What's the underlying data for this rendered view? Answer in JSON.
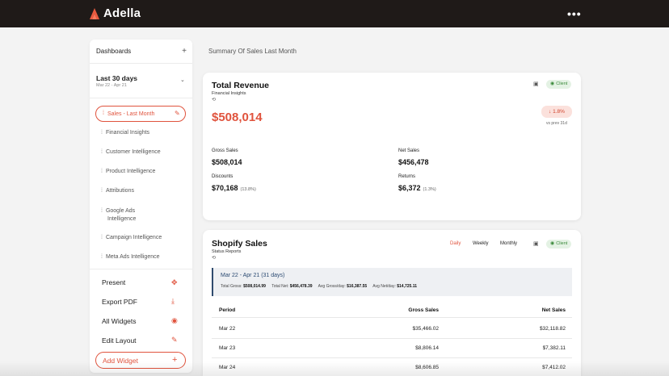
{
  "app": {
    "name": "Adella",
    "more_menu": "•••"
  },
  "sidebar": {
    "header": "Dashboards",
    "header_add": "+",
    "date_range": {
      "title": "Last 30 days",
      "sub": "Mar 22 - Apr 21",
      "chevron": "⌄"
    },
    "active_item": "Sales - Last Month",
    "items": [
      {
        "label": "Financial Insights"
      },
      {
        "label": "Customer Intelligence"
      },
      {
        "label": "Product Intelligence"
      },
      {
        "label": "Attributions"
      },
      {
        "label_line1": "Google Ads",
        "label_line2": "Intelligence"
      },
      {
        "label": "Campaign Intelligence"
      },
      {
        "label": "Meta Ads Intelligence"
      }
    ],
    "actions": [
      {
        "label": "Present",
        "icon": "present-icon"
      },
      {
        "label": "Export PDF",
        "icon": "download-icon"
      },
      {
        "label": "All Widgets",
        "icon": "eye-icon"
      },
      {
        "label": "Edit Layout",
        "icon": "edit-layout-icon"
      }
    ],
    "add_widget": "Add Widget"
  },
  "main": {
    "summary_title": "Summary Of Sales Last Month",
    "revenue_card": {
      "title": "Total Revenue",
      "subtitle": "Financial Insights",
      "badge": "Client",
      "total": "$508,014",
      "delta": "1.8%",
      "delta_sub": "vs prev 31d",
      "metrics": {
        "gross_sales": {
          "label": "Gross Sales",
          "value": "$508,014"
        },
        "net_sales": {
          "label": "Net Sales",
          "value": "$456,478"
        },
        "discounts": {
          "label": "Discounts",
          "value": "$70,168",
          "pct": "(13.8%)"
        },
        "returns": {
          "label": "Returns",
          "value": "$6,372",
          "pct": "(1.3%)"
        }
      }
    },
    "shopify_card": {
      "title": "Shopify Sales",
      "subtitle": "Status Reports",
      "tabs": {
        "daily": "Daily",
        "weekly": "Weekly",
        "monthly": "Monthly"
      },
      "badge": "Client",
      "period": {
        "title": "Mar 22 - Apr 21 (31 days)",
        "total_gross_label": "Total Gross:",
        "total_gross": "$508,014.99",
        "total_net_label": "Total Net:",
        "total_net": "$456,478.39",
        "avg_gross_label": "Avg Gross/day:",
        "avg_gross": "$16,387.55",
        "avg_net_label": "Avg Net/day:",
        "avg_net": "$14,725.11"
      },
      "columns": {
        "period": "Period",
        "gross": "Gross Sales",
        "net": "Net Sales"
      },
      "rows": [
        {
          "period": "Mar 22",
          "gross": "$35,466.02",
          "net": "$32,118.82"
        },
        {
          "period": "Mar 23",
          "gross": "$8,806.14",
          "net": "$7,382.11"
        },
        {
          "period": "Mar 24",
          "gross": "$8,606.85",
          "net": "$7,412.02"
        }
      ]
    }
  },
  "colors": {
    "accent": "#e0533d",
    "topbar": "#1f1a18",
    "client_badge": "#3b8a3b",
    "period_border": "#2f4b6e"
  }
}
